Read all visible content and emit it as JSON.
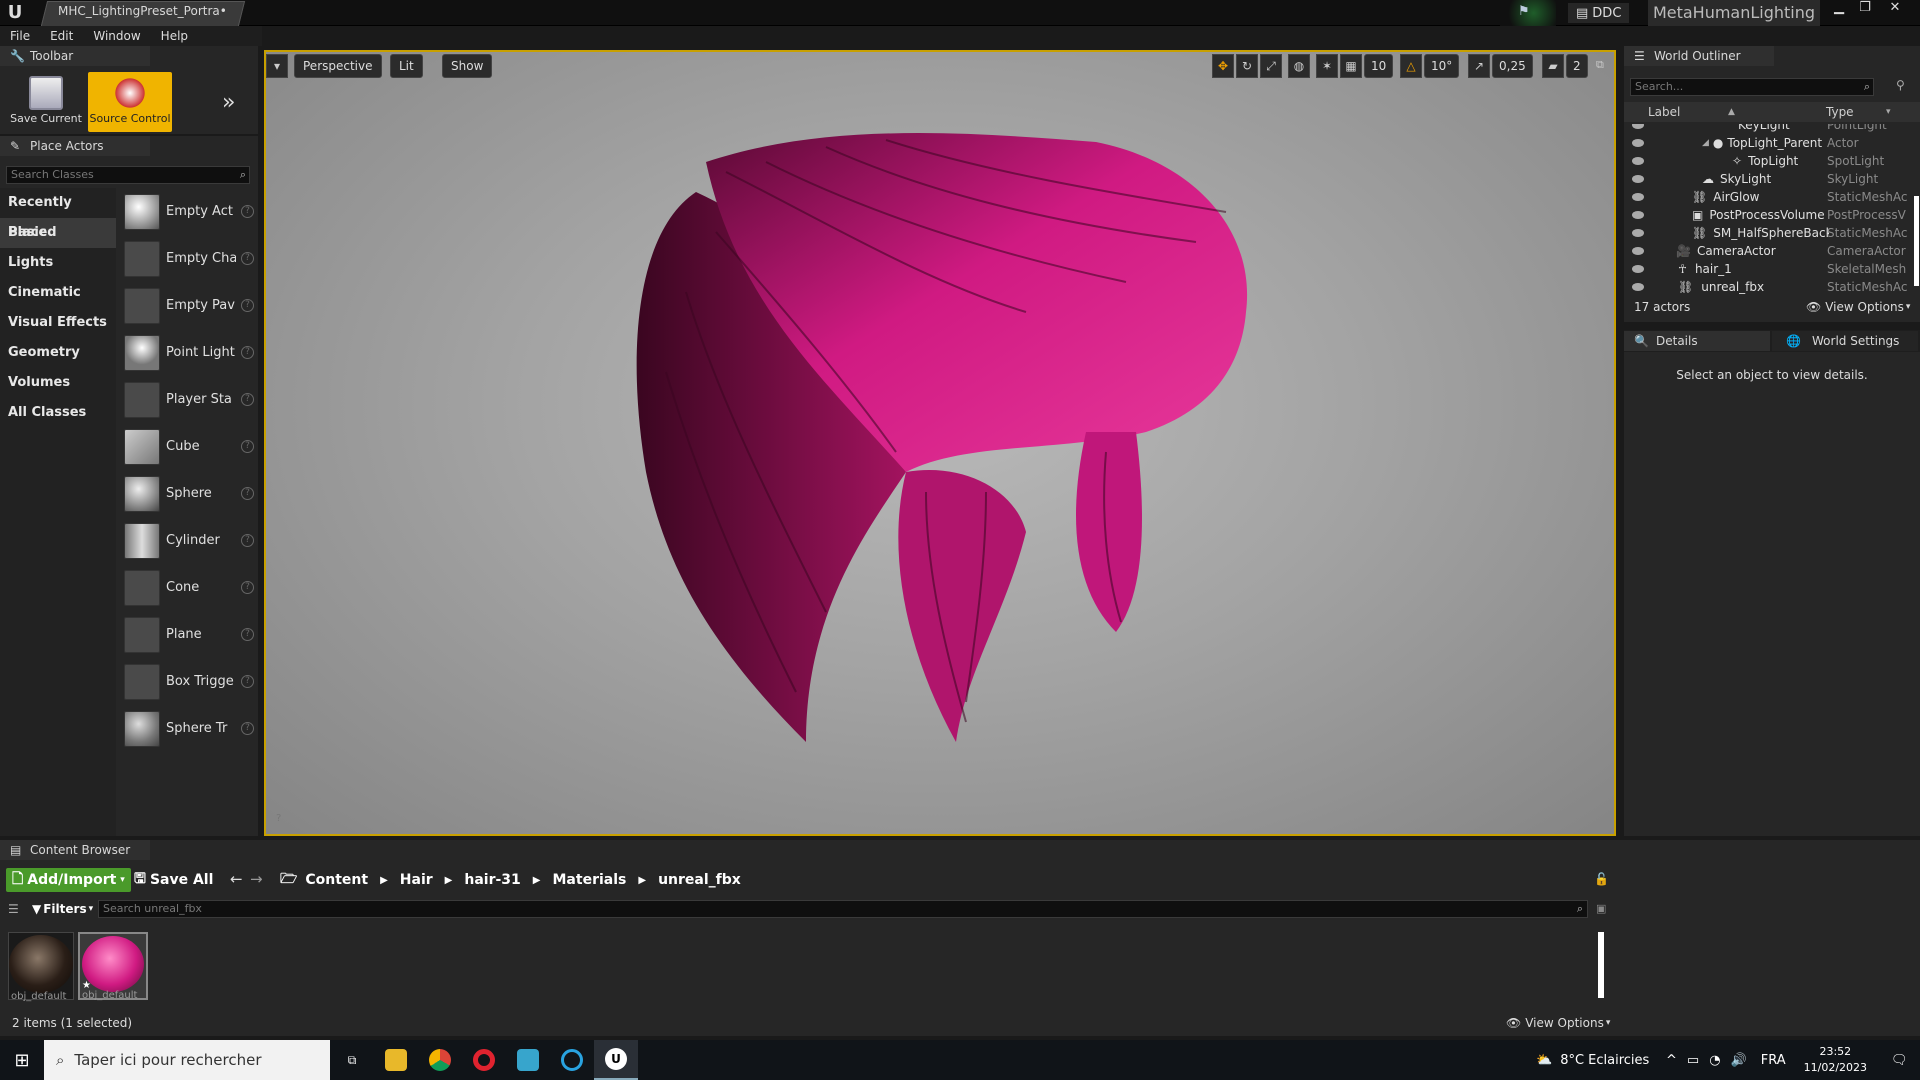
{
  "window": {
    "tab_title": "MHC_LightingPreset_Portra•",
    "ddc_label": "DDC",
    "project_name": "MetaHumanLighting"
  },
  "menu": [
    "File",
    "Edit",
    "Window",
    "Help"
  ],
  "toolbar_panel": {
    "tab": "Toolbar",
    "save_current": "Save Current",
    "source_control": "Source Control"
  },
  "place_actors": {
    "tab": "Place Actors",
    "search_placeholder": "Search Classes",
    "categories": [
      "Recently Placed",
      "Basic",
      "Lights",
      "Cinematic",
      "Visual Effects",
      "Geometry",
      "Volumes",
      "All Classes"
    ],
    "selected_category": "Basic",
    "items": [
      "Empty Act",
      "Empty Cha",
      "Empty Pav",
      "Point Light",
      "Player Sta",
      "Cube",
      "Sphere",
      "Cylinder",
      "Cone",
      "Plane",
      "Box Trigge",
      "Sphere Tr"
    ]
  },
  "viewport": {
    "perspective": "Perspective",
    "lit": "Lit",
    "show": "Show",
    "grid_snap": "10",
    "rot_snap": "10°",
    "scale_snap": "0,25",
    "camera_speed": "2",
    "hair_color": "#d01a82"
  },
  "outliner": {
    "tab": "World Outliner",
    "search_placeholder": "Search...",
    "col_label": "Label",
    "col_type": "Type",
    "rows": [
      {
        "label": "KeyLight",
        "type": "PointLight",
        "indent": 4
      },
      {
        "label": "TopLight_Parent",
        "type": "Actor",
        "indent": 3
      },
      {
        "label": "TopLight",
        "type": "SpotLight",
        "indent": 4
      },
      {
        "label": "SkyLight",
        "type": "SkyLight",
        "indent": 2
      },
      {
        "label": "AirGlow",
        "type": "StaticMeshAc",
        "indent": 2
      },
      {
        "label": "PostProcessVolume",
        "type": "PostProcessV",
        "indent": 2
      },
      {
        "label": "SM_HalfSphereBackg",
        "type": "StaticMeshAc",
        "indent": 2
      },
      {
        "label": "CameraActor",
        "type": "CameraActor",
        "indent": 1
      },
      {
        "label": "hair_1",
        "type": "SkeletalMesh",
        "indent": 1
      },
      {
        "label": "unreal_fbx",
        "type": "StaticMeshAc",
        "indent": 1
      }
    ],
    "count": "17 actors",
    "view_options": "View Options"
  },
  "details": {
    "tab_details": "Details",
    "tab_world_settings": "World Settings",
    "empty_message": "Select an object to view details."
  },
  "content_browser": {
    "tab": "Content Browser",
    "add_import": "Add/Import",
    "save_all": "Save All",
    "breadcrumb": [
      "Content",
      "Hair",
      "hair-31",
      "Materials",
      "unreal_fbx"
    ],
    "filters": "Filters",
    "search_placeholder": "Search unreal_fbx",
    "assets": [
      {
        "label": "obj_default",
        "color": "#2a1e17"
      },
      {
        "label": "obj_default",
        "color": "#d01a82"
      }
    ],
    "status": "2 items (1 selected)",
    "view_options": "View Options"
  },
  "taskbar": {
    "search_placeholder": "Taper ici pour rechercher",
    "weather": "8°C  Eclaircies",
    "language": "FRA",
    "time": "23:52",
    "date": "11/02/2023"
  }
}
